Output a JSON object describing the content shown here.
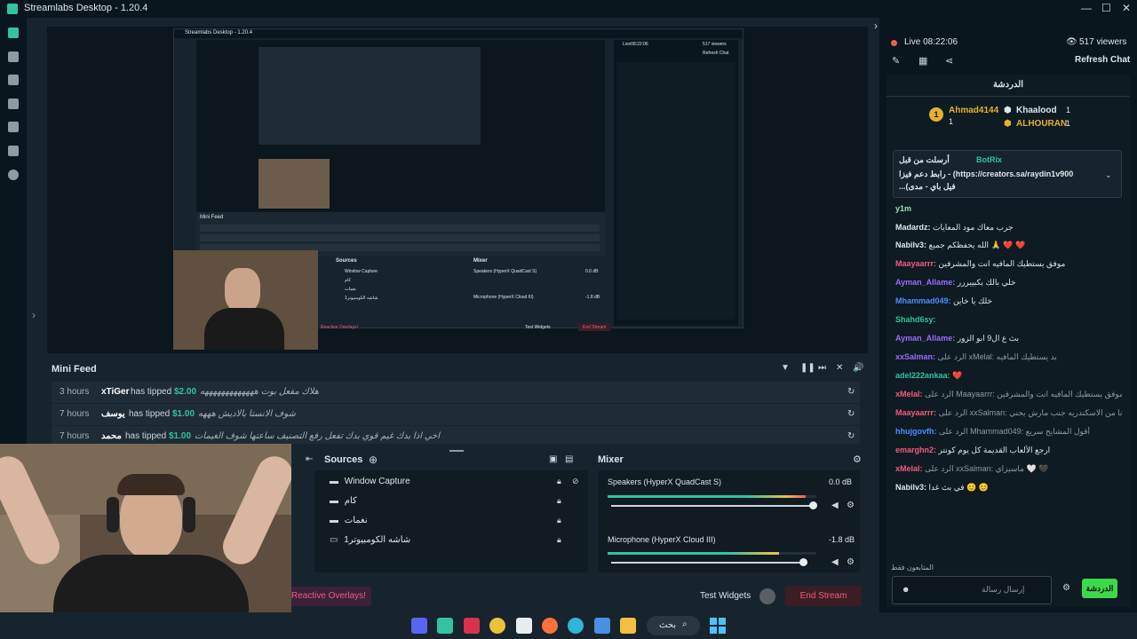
{
  "titlebar": {
    "title": "Streamlabs Desktop - 1.20.4",
    "minimize": "—",
    "maximize": "☐",
    "close": "✕"
  },
  "preview": {
    "inner_title": "Streamlabs Desktop - 1.20.4",
    "inner_live": "Live08:22:06",
    "inner_viewers": "517 viewers",
    "inner_refresh": "Refresh Chat",
    "inner_minifeed": "Mini Feed",
    "inner_sources": "Sources",
    "inner_mixer": "Mixer",
    "inner_mixer_speakers": "Speakers (HyperX QuadCast S)",
    "inner_mixer_speakers_db": "0.0 dB",
    "inner_mixer_mic": "Microphone (HyperX Cloud III)",
    "inner_mixer_mic_db": "-1.8 dB",
    "inner_test_widgets": "Test Widgets",
    "inner_end_stream": "End Stream",
    "inner_reactive": "Reactive Overlays!",
    "inner_sources_list": [
      "Window Capture",
      "كام",
      "نغمات",
      "شاشه الكومبيوتر1"
    ]
  },
  "minifeed": {
    "title": "Mini Feed",
    "rows": [
      {
        "time": "3 hours",
        "user": "xTiGer",
        "action": "has tipped",
        "amount": "$2.00",
        "message": "هلاك مفعل بوت هههههههههههههه"
      },
      {
        "time": "7 hours",
        "user": "يوسف",
        "action": "has tipped",
        "amount": "$1.00",
        "message": "شوف الانستا بالاديش هههه"
      },
      {
        "time": "7 hours",
        "user": "محمد",
        "action": "has tipped",
        "amount": "$1.00",
        "message": "اخي اذا بدك غيم قوي بدك تفعل رفع التصنيف ساعتها شوف الغيمات"
      }
    ]
  },
  "sources": {
    "title": "Sources",
    "items": [
      "Window Capture",
      "كام",
      "نغمات",
      "شاشه الكومبيوتر1"
    ]
  },
  "mixer": {
    "title": "Mixer",
    "channels": [
      {
        "name": "Speakers (HyperX QuadCast S)",
        "db": "0.0 dB",
        "level": 0.95
      },
      {
        "name": "Microphone (HyperX Cloud III)",
        "db": "-1.8 dB",
        "level": 0.82
      }
    ]
  },
  "footer": {
    "reactive": "Reactive Overlays!",
    "test_widgets": "Test Widgets",
    "end_stream": "End Stream"
  },
  "chat": {
    "live": "Live 08:22:06",
    "viewers": "517 viewers",
    "refresh": "Refresh Chat",
    "header": "الدردشة",
    "leaderboard": [
      {
        "rank": "1",
        "name": "Ahmad4144",
        "count": "1"
      },
      {
        "name": "Khaalood",
        "count": "1"
      },
      {
        "name": "ALHOURAN",
        "count": "1"
      }
    ],
    "pinned": {
      "label": "أرسلت من قبل",
      "user": "BotRix",
      "text1": "رابط دعم فيزا - (https://creators.sa/raydin1v900",
      "text2": "...(فيل باي - مدى"
    },
    "messages": [
      {
        "user": "y1m",
        "text": "",
        "color": "#a3e0b8"
      },
      {
        "user": "Madardz:",
        "text": "جرب معاك مود المعايات",
        "color": "#dfe6ea"
      },
      {
        "user": "Nabilv3:",
        "text": "الله يحفظكم جميع 🙏 ❤️ ❤️",
        "color": "#dfe6ea"
      },
      {
        "user": "Maayaarrr:",
        "text": "موفق يستطيك المافيه انت والمشرفين",
        "color": "#f35b7e"
      },
      {
        "user": "Ayman_Allame:",
        "text": "خلي بالك بكبييررر",
        "color": "#9b6bff"
      },
      {
        "user": "Mhammad049:",
        "text": "خلك يا خاين",
        "color": "#4d8eff"
      },
      {
        "user": "Shahd6sy:",
        "text": "",
        "color": "#31c3a2"
      },
      {
        "user": "Ayman_Allame:",
        "text": "بث ع ال9 ابو الزور",
        "color": "#9b6bff"
      },
      {
        "user": "xxSalman:",
        "text": "الرد على xMelal: بد يستطيك المافيه",
        "color": "#9b6bff"
      },
      {
        "user": "adel222ankaa:",
        "text": "❤️",
        "color": "#31c3a2"
      },
      {
        "user": "xMelal:",
        "text": "الرد على Maayaarrr: موفق يستطيك المافيه انت والمشرفين ❤️ ❤️",
        "color": "#f35b7e"
      },
      {
        "user": "Maayaarrr:",
        "text": "الرد على xxSalman: ده انا من الاسكندريه جنب مارش يحني",
        "color": "#f35b7e"
      },
      {
        "user": "hhujgovfh:",
        "text": "الرد على Mhammad049: أقول المشايح سريع",
        "color": "#4d8eff"
      },
      {
        "user": "emarghn2:",
        "text": "ارجع الألعاب القديمة كل يوم كونتر",
        "color": "#f35b7e"
      },
      {
        "user": "xMelal:",
        "text": "الرد على xxSalman: ماسيزاي 🤍 🖤",
        "color": "#f35b7e"
      },
      {
        "user": "Nabilv3:",
        "text": "في بث غدا 😊 😊",
        "color": "#dfe6ea"
      }
    ],
    "followers_only": "المتابعون فقط",
    "input_placeholder": "إرسال رسالة",
    "send": "الدردشة"
  },
  "taskbar": {
    "search": "بحث"
  },
  "colors": {
    "accent": "#31c3a2",
    "bg": "#17242d",
    "nav": "#09161d",
    "live_red": "#f35b5b",
    "chat_send": "#3cd94a"
  }
}
